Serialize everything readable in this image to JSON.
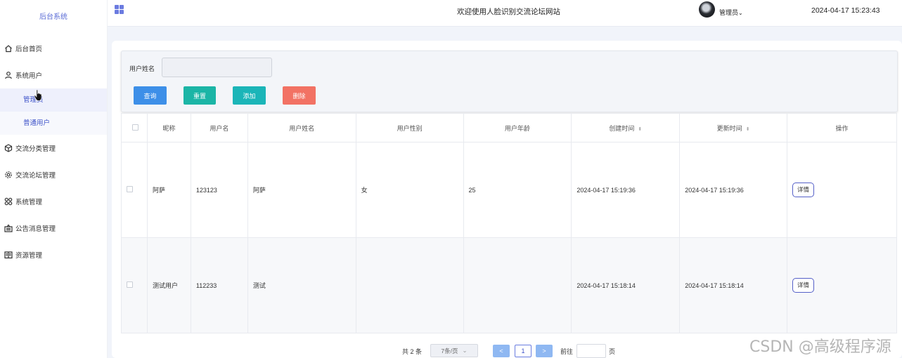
{
  "sidebar": {
    "brand": "后台系统",
    "items": [
      {
        "label": "后台首页",
        "icon": "home-icon"
      },
      {
        "label": "系统用户",
        "icon": "user-icon"
      },
      {
        "label": "交流分类管理",
        "icon": "cube-icon"
      },
      {
        "label": "交流论坛管理",
        "icon": "gear-icon"
      },
      {
        "label": "系统管理",
        "icon": "grid-icon"
      },
      {
        "label": "公告消息管理",
        "icon": "notice-icon"
      },
      {
        "label": "资源管理",
        "icon": "book-icon"
      }
    ],
    "sub_items": [
      {
        "label": "管理员",
        "active": true
      },
      {
        "label": "普通用户",
        "active": false
      }
    ]
  },
  "header": {
    "site_title": "欢迎使用人脸识别交流论坛网站",
    "user_name": "管理员",
    "datetime": "2024-04-17 15:23:43"
  },
  "search": {
    "label": "用户姓名",
    "value": "",
    "buttons": {
      "search": "查询",
      "reset": "重置",
      "add": "添加",
      "delete": "删除"
    }
  },
  "table": {
    "headers": [
      "昵称",
      "用户名",
      "用户姓名",
      "用户性别",
      "用户年龄",
      "创建时间",
      "更新时间",
      "操作"
    ],
    "rows": [
      {
        "nickname": "阿萨",
        "username": "123123",
        "realname": "阿萨",
        "gender": "女",
        "age": "25",
        "created": "2024-04-17 15:19:36",
        "updated": "2024-04-17 15:19:36",
        "action": "详情"
      },
      {
        "nickname": "测试用户",
        "username": "112233",
        "realname": "测试",
        "gender": "",
        "age": "",
        "created": "2024-04-17 15:18:14",
        "updated": "2024-04-17 15:18:14",
        "action": "详情"
      }
    ]
  },
  "pagination": {
    "total": "共 2 条",
    "page_size": "7条/页",
    "prev": "<",
    "current": "1",
    "next": ">",
    "goto_label": "前往",
    "goto_value": "",
    "unit": "页"
  },
  "watermark": "CSDN @高级程序源",
  "colors": {
    "accent": "#3b50c8",
    "search_btn": "#3d8fe8",
    "reset_btn": "#1bb5a6",
    "add_btn": "#1bb5b8",
    "delete_btn": "#f27264"
  }
}
